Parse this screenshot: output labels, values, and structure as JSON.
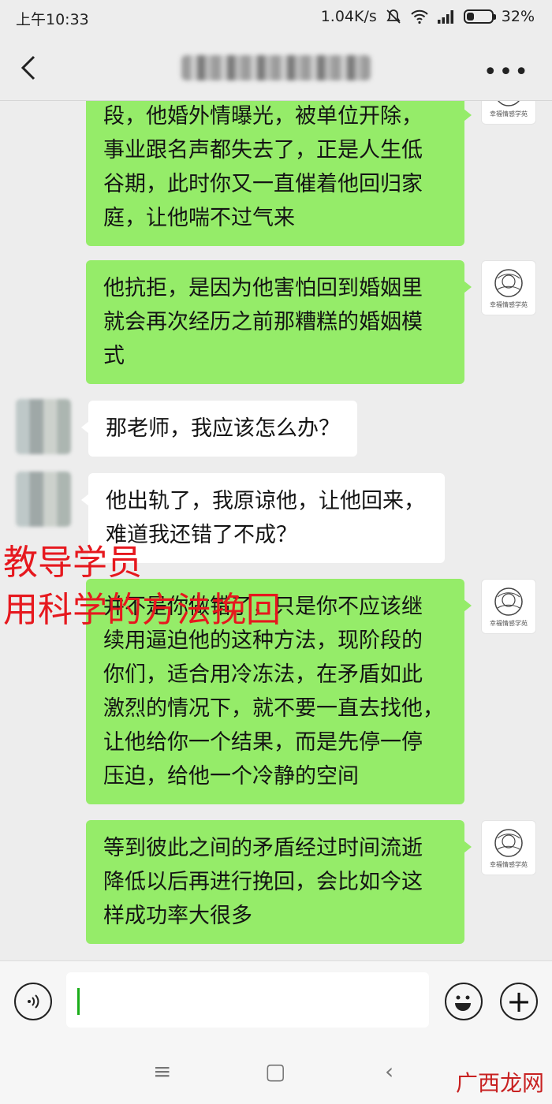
{
  "status_bar": {
    "time": "上午10:33",
    "network_speed": "1.04K/s",
    "battery": "32%",
    "battery_level": 0.32,
    "icons": [
      "mute-icon",
      "wifi-icon",
      "signal-icon",
      "battery-icon"
    ]
  },
  "title_bar": {
    "back_icon": "chevron-left-icon",
    "title": "██████████",
    "more": "•••"
  },
  "messages": [
    {
      "side": "out",
      "text": "段，他婚外情曝光，被单位开除，\n事业跟名声都失去了，正是人生低\n谷期，此时你又一直催着他回归家\n庭，让他喘不过气来"
    },
    {
      "side": "out",
      "text": "他抗拒，是因为他害怕回到婚姻里\n就会再次经历之前那糟糕的婚姻模\n式"
    },
    {
      "side": "in",
      "text": "那老师，我应该怎么办？"
    },
    {
      "side": "in",
      "text": "他出轨了，我原谅他，让他回来，\n难道我还错了不成？"
    },
    {
      "side": "out",
      "text": "并不是你做错了，只是你不应该继\n续用逼迫他的这种方法，现阶段的\n你们，适合用冷冻法，在矛盾如此\n激烈的情况下，就不要一直去找他，\n让他给你一个结果，而是先停一停\n压迫，给他一个冷静的空间"
    },
    {
      "side": "out",
      "text": "等到彼此之间的矛盾经过时间流逝\n降低以后再进行挽回，会比如今这\n样成功率大很多"
    }
  ],
  "avatar_self_caption": "幸福情感学苑",
  "overlay": {
    "line1": "教导学员",
    "line2": "用科学的方法挽回",
    "color": "#e6181e"
  },
  "input_bar": {
    "voice_icon": "voice-icon",
    "emoji_icon": "emoji-icon",
    "plus": "+"
  },
  "nav_bar": {
    "menu": "≡",
    "home": "▢",
    "back": "‹"
  },
  "watermark": "广西龙网",
  "colors": {
    "bubble_out": "#95ec69",
    "bubble_in": "#ffffff",
    "background": "#ededed"
  }
}
